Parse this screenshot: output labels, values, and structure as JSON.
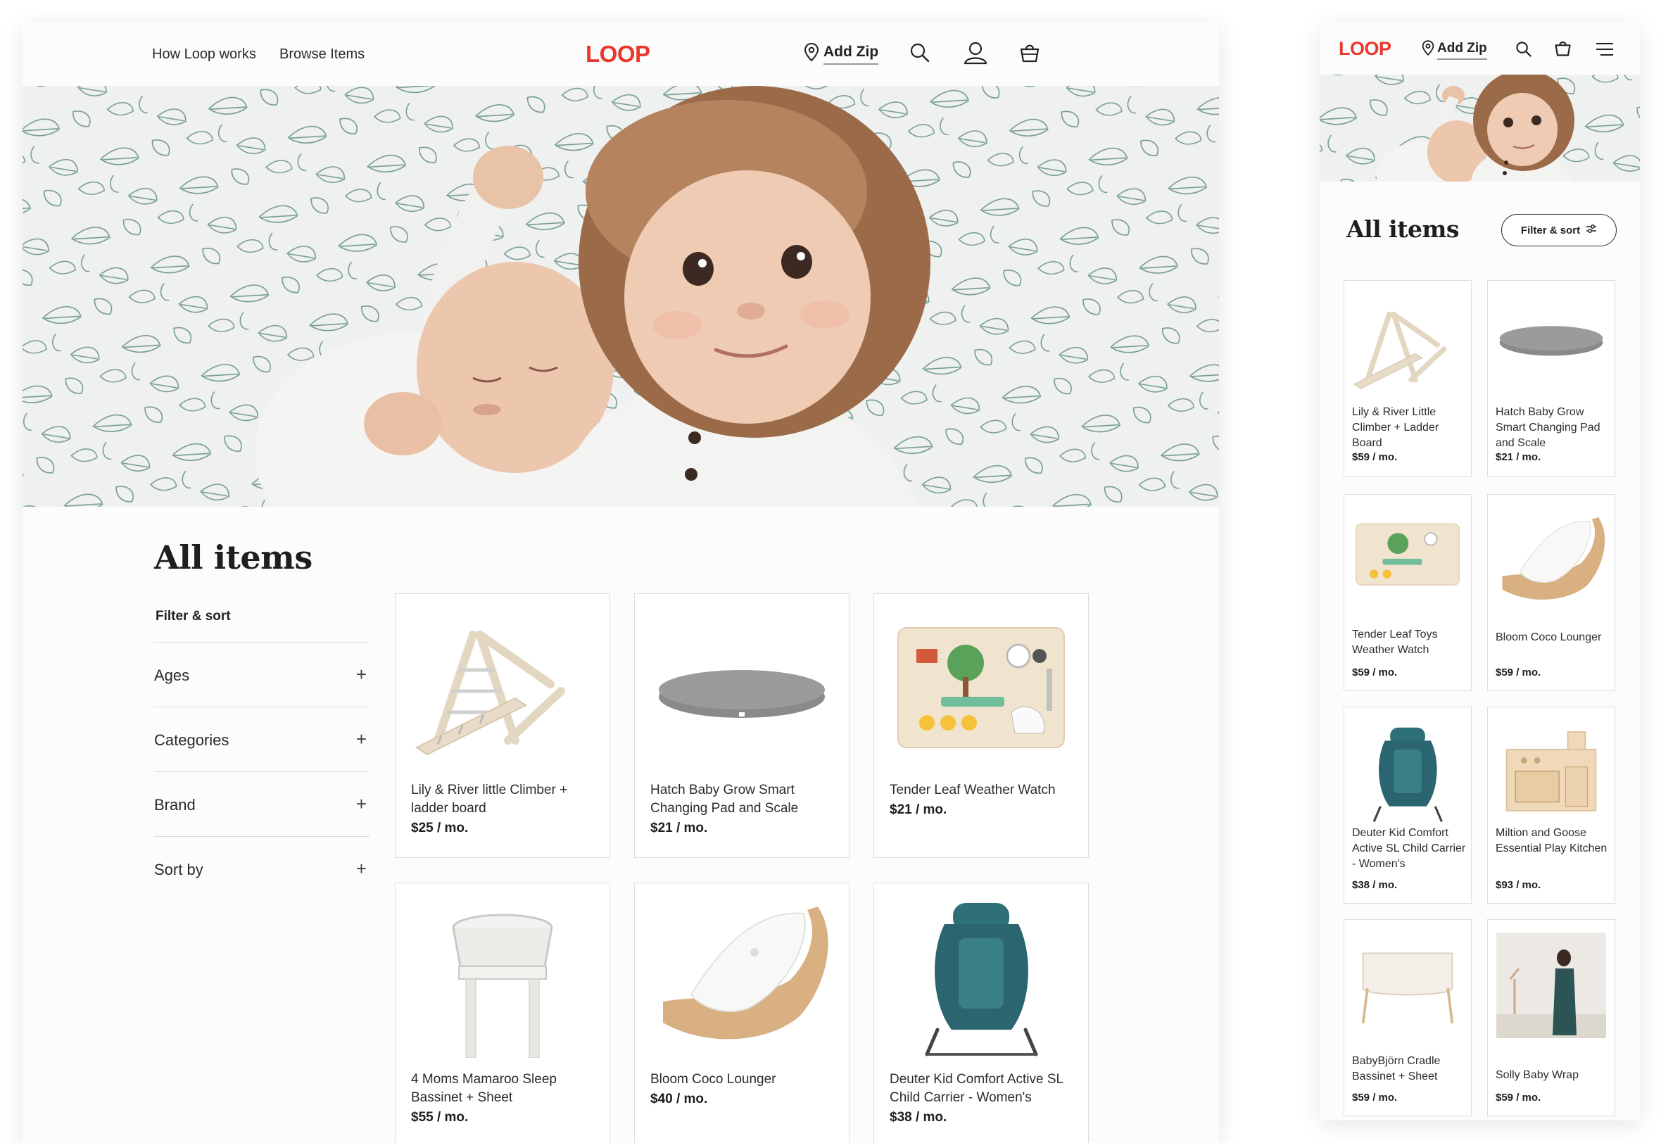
{
  "desktop": {
    "nav": {
      "how_label": "How Loop works",
      "browse_label": "Browse Items",
      "logo": "LOOP",
      "zip_label": "Add Zip"
    },
    "title": "All items",
    "filter_label": "Filter & sort",
    "facets": [
      "Ages",
      "Categories",
      "Brand",
      "Sort by"
    ],
    "products": [
      {
        "name": "Lily & River little Climber + ladder board",
        "price": "$25 / mo."
      },
      {
        "name": "Hatch Baby Grow Smart Changing Pad and Scale",
        "price": "$21 / mo."
      },
      {
        "name": "Tender Leaf Weather Watch",
        "price": "$21 / mo."
      },
      {
        "name": "4 Moms Mamaroo Sleep Bassinet + Sheet",
        "price": "$55 / mo."
      },
      {
        "name": "Bloom Coco Lounger",
        "price": "$40 / mo."
      },
      {
        "name": "Deuter Kid Comfort Active SL Child Carrier - Women's",
        "price": "$38 / mo."
      }
    ]
  },
  "mobile": {
    "logo": "LOOP",
    "zip_label": "Add Zip",
    "title": "All items",
    "filter_label": "Filter & sort",
    "products": [
      {
        "name": "Lily & River Little Climber + Ladder Board",
        "price": "$59 / mo."
      },
      {
        "name": "Hatch Baby Grow Smart Changing Pad and Scale",
        "price": "$21 / mo."
      },
      {
        "name": "Tender Leaf Toys Weather Watch",
        "price": "$59 / mo."
      },
      {
        "name": "Bloom Coco Lounger",
        "price": "$59 / mo."
      },
      {
        "name": "Deuter Kid Comfort Active SL Child Carrier - Women's",
        "price": "$38 / mo."
      },
      {
        "name": "Miltion and Goose Essential Play Kitchen",
        "price": "$93 / mo."
      },
      {
        "name": "BabyBjörn Cradle Bassinet + Sheet",
        "price": "$59 / mo."
      },
      {
        "name": "Solly Baby Wrap",
        "price": "$59 / mo."
      }
    ]
  },
  "colors": {
    "brand": "#e8382b",
    "border": "#dddddd",
    "background": "#fcfcfc"
  }
}
